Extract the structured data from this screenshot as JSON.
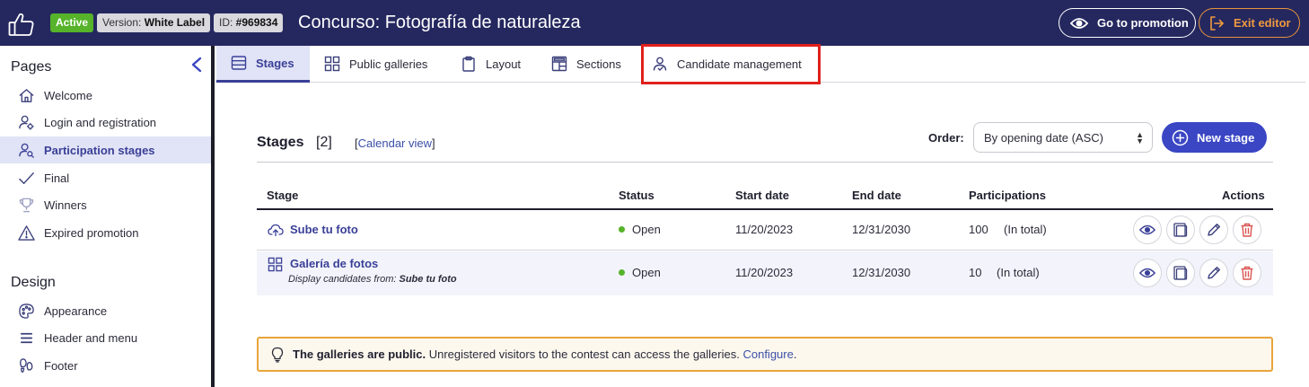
{
  "topbar": {
    "status_badge": "Active",
    "version_label": "Version: ",
    "version_value": "White Label",
    "id_label": "ID: ",
    "id_value": "#969834",
    "title": "Concurso: Fotografía de naturaleza",
    "goto_label": "Go to promotion",
    "exit_label": "Exit editor"
  },
  "sidebar": {
    "pages_heading": "Pages",
    "pages": [
      {
        "label": "Welcome",
        "icon": "home-icon"
      },
      {
        "label": "Login and registration",
        "icon": "user-settings-icon"
      },
      {
        "label": "Participation stages",
        "icon": "user-search-icon",
        "active": true
      },
      {
        "label": "Final",
        "icon": "check-icon"
      },
      {
        "label": "Winners",
        "icon": "trophy-icon"
      },
      {
        "label": "Expired promotion",
        "icon": "warning-icon"
      }
    ],
    "design_heading": "Design",
    "design": [
      {
        "label": "Appearance",
        "icon": "palette-icon"
      },
      {
        "label": "Header and menu",
        "icon": "menu-icon"
      },
      {
        "label": "Footer",
        "icon": "footer-icon"
      }
    ]
  },
  "tabs": [
    {
      "label": "Stages",
      "icon": "list-icon",
      "active": true
    },
    {
      "label": "Public galleries",
      "icon": "grid-icon"
    },
    {
      "label": "Layout",
      "icon": "clipboard-icon"
    },
    {
      "label": "Sections",
      "icon": "sections-icon"
    },
    {
      "label": "Candidate management",
      "icon": "user-manage-icon"
    }
  ],
  "stages": {
    "title": "Stages",
    "count": "[2]",
    "calendar_open": "[",
    "calendar_link": "Calendar view",
    "calendar_close": "]",
    "order_label": "Order:",
    "order_value": "By opening date (ASC)",
    "new_stage": "New stage",
    "columns": [
      "Stage",
      "Status",
      "Start date",
      "End date",
      "Participations",
      "Actions"
    ],
    "rows": [
      {
        "name": "Sube tu foto",
        "icon": "cloud-upload-icon",
        "status": "Open",
        "start": "11/20/2023",
        "end": "12/31/2030",
        "participations": "100",
        "participations_note": "(In total)"
      },
      {
        "name": "Galería de fotos",
        "icon": "grid-icon",
        "subtitle_prefix": "Display candidates from: ",
        "subtitle_value": "Sube tu foto",
        "status": "Open",
        "start": "11/20/2023",
        "end": "12/31/2030",
        "participations": "10",
        "participations_note": "(In total)"
      }
    ]
  },
  "notice": {
    "bold": "The galleries are public.",
    "text": " Unregistered visitors to the contest can access the galleries. ",
    "link": "Configure",
    "end": "."
  },
  "colors": {
    "topbar_bg": "#25285f",
    "accent": "#3a46c4",
    "active_bg": "#e1e3f6",
    "status_open": "#56b32a",
    "warning_border": "#e8a53a",
    "highlight": "#e0201b",
    "delete": "#d9534f"
  }
}
